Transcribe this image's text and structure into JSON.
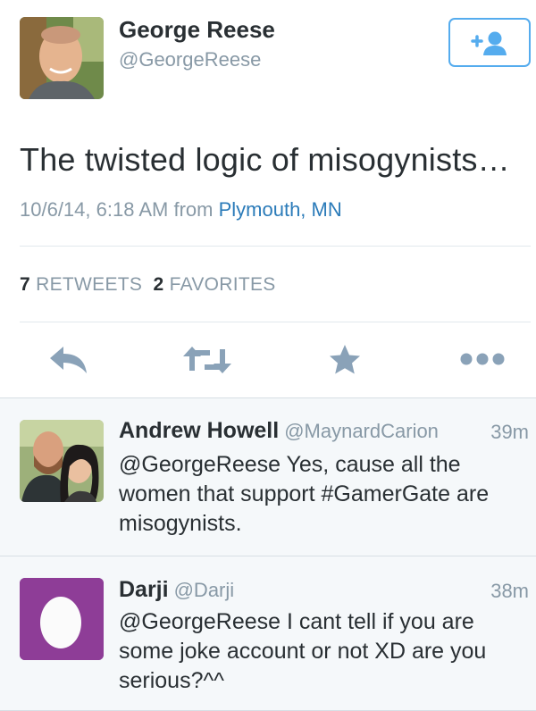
{
  "tweet": {
    "author_name": "George Reese",
    "author_handle": "@GeorgeReese",
    "text": "The twisted logic of misogynists…",
    "timestamp": "10/6/14, 6:18 AM",
    "from_label": "from",
    "location": "Plymouth, MN",
    "retweets_count": "7",
    "retweets_label": "RETWEETS",
    "favorites_count": "2",
    "favorites_label": "FAVORITES"
  },
  "replies": [
    {
      "name": "Andrew Howell",
      "handle": "@MaynardCarion",
      "time": "39m",
      "text": "@GeorgeReese Yes, cause all the women that support #GamerGate are misogynists."
    },
    {
      "name": "Darji",
      "handle": "@Darji",
      "time": "38m",
      "text": "@GeorgeReese I cant tell if you are some joke account or not XD are you serious?^^"
    }
  ],
  "icons": {
    "follow": "add-user-icon",
    "reply": "reply-icon",
    "retweet": "retweet-icon",
    "favorite": "star-icon",
    "more": "more-icon"
  },
  "colors": {
    "accent": "#55acee",
    "link": "#2b7bb9",
    "muted": "#8899a6",
    "action_icon": "#8aa2b8",
    "egg_background": "#8e3d97"
  }
}
